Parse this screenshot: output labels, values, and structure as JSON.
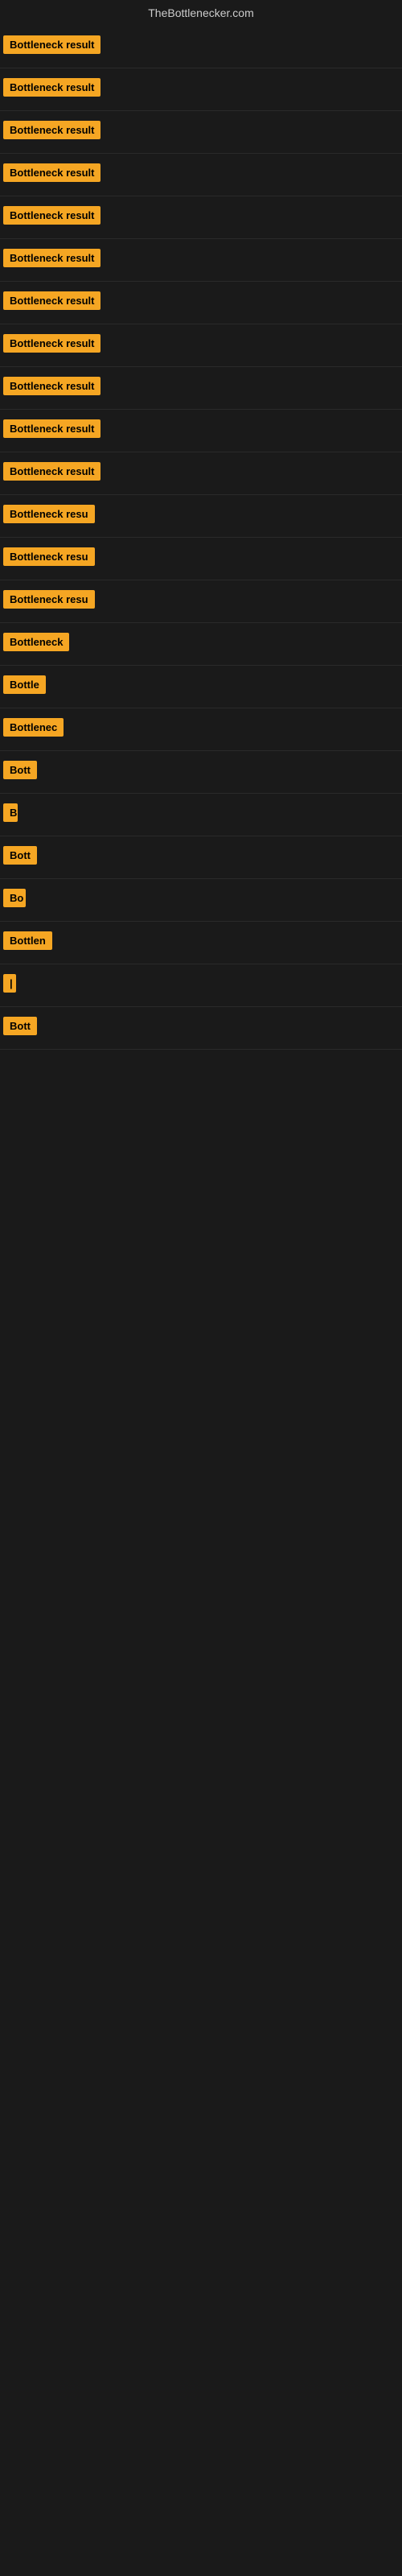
{
  "site": {
    "title": "TheBottlenecker.com"
  },
  "rows": [
    {
      "id": 1,
      "label": "Bottleneck result",
      "width": 155
    },
    {
      "id": 2,
      "label": "Bottleneck result",
      "width": 155
    },
    {
      "id": 3,
      "label": "Bottleneck result",
      "width": 155
    },
    {
      "id": 4,
      "label": "Bottleneck result",
      "width": 155
    },
    {
      "id": 5,
      "label": "Bottleneck result",
      "width": 155
    },
    {
      "id": 6,
      "label": "Bottleneck result",
      "width": 155
    },
    {
      "id": 7,
      "label": "Bottleneck result",
      "width": 155
    },
    {
      "id": 8,
      "label": "Bottleneck result",
      "width": 155
    },
    {
      "id": 9,
      "label": "Bottleneck result",
      "width": 155
    },
    {
      "id": 10,
      "label": "Bottleneck result",
      "width": 155
    },
    {
      "id": 11,
      "label": "Bottleneck result",
      "width": 155
    },
    {
      "id": 12,
      "label": "Bottleneck resu",
      "width": 130
    },
    {
      "id": 13,
      "label": "Bottleneck resu",
      "width": 130
    },
    {
      "id": 14,
      "label": "Bottleneck resu",
      "width": 130
    },
    {
      "id": 15,
      "label": "Bottleneck",
      "width": 95
    },
    {
      "id": 16,
      "label": "Bottle",
      "width": 60
    },
    {
      "id": 17,
      "label": "Bottlenec",
      "width": 85
    },
    {
      "id": 18,
      "label": "Bott",
      "width": 45
    },
    {
      "id": 19,
      "label": "B",
      "width": 18
    },
    {
      "id": 20,
      "label": "Bott",
      "width": 45
    },
    {
      "id": 21,
      "label": "Bo",
      "width": 28
    },
    {
      "id": 22,
      "label": "Bottlen",
      "width": 70
    },
    {
      "id": 23,
      "label": "|",
      "width": 10
    },
    {
      "id": 24,
      "label": "Bott",
      "width": 45
    }
  ]
}
